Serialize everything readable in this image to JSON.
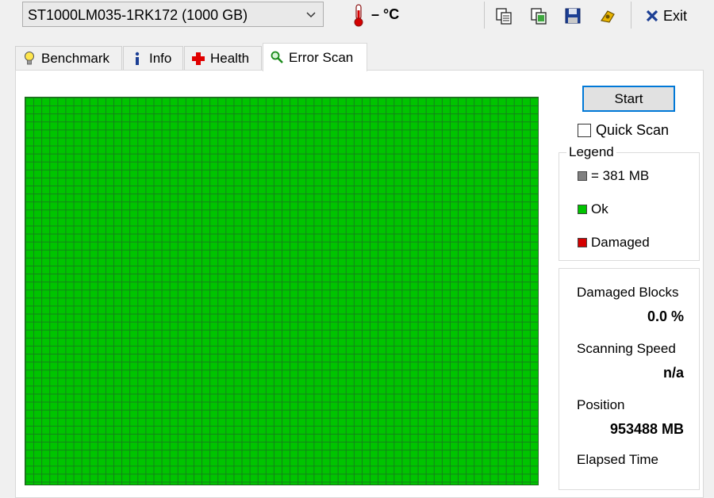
{
  "toolbar": {
    "drive": "ST1000LM035-1RK172 (1000 GB)",
    "temperature": "– °C",
    "icons": [
      "copy-icon",
      "copy-screenshot-icon",
      "save-icon",
      "options-icon"
    ],
    "exit_label": "Exit"
  },
  "tabs": [
    {
      "label": "Benchmark",
      "icon": "bulb-icon"
    },
    {
      "label": "Info",
      "icon": "info-icon"
    },
    {
      "label": "Health",
      "icon": "health-cross-icon"
    },
    {
      "label": "Error Scan",
      "icon": "magnifier-icon",
      "active": true
    }
  ],
  "scan": {
    "start_label": "Start",
    "quick_scan_label": "Quick Scan",
    "quick_scan_checked": false
  },
  "legend": {
    "title": "Legend",
    "block_size": "= 381 MB",
    "ok": "Ok",
    "damaged": "Damaged",
    "colors": {
      "block": "#808080",
      "ok": "#00c400",
      "damaged": "#d40000"
    }
  },
  "stats": {
    "damaged_blocks_label": "Damaged Blocks",
    "damaged_blocks_value": "0.0 %",
    "scanning_speed_label": "Scanning Speed",
    "scanning_speed_value": "n/a",
    "position_label": "Position",
    "position_value": "953488 MB",
    "elapsed_time_label": "Elapsed Time"
  }
}
